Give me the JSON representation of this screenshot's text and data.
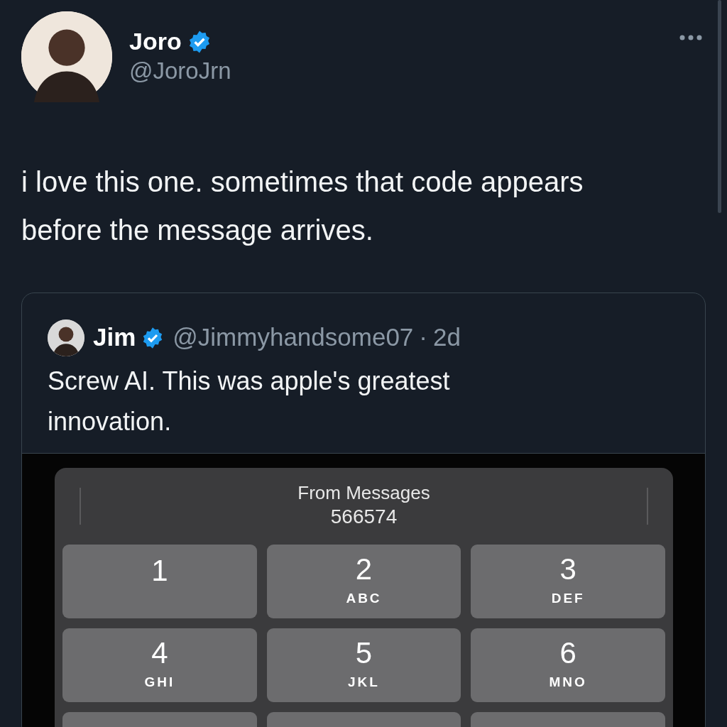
{
  "post": {
    "author": {
      "name": "Joro",
      "verified": true,
      "handle": "@JoroJrn"
    },
    "text": "i love this one. sometimes that code appears before the message arrives.",
    "quote": {
      "author": {
        "name": "Jim",
        "verified": true,
        "handle": "@Jimmyhandsome07",
        "separator": "·",
        "time": "2d"
      },
      "text": "Screw AI. This was apple's greatest innovation.",
      "media": {
        "suggestion": {
          "label": "From Messages",
          "code": "566574"
        },
        "keys": [
          {
            "digit": "1"
          },
          {
            "digit": "2",
            "letters": "ABC"
          },
          {
            "digit": "3",
            "letters": "DEF"
          },
          {
            "digit": "4",
            "letters": "GHI"
          },
          {
            "digit": "5",
            "letters": "JKL"
          },
          {
            "digit": "6",
            "letters": "MNO"
          }
        ]
      }
    }
  }
}
